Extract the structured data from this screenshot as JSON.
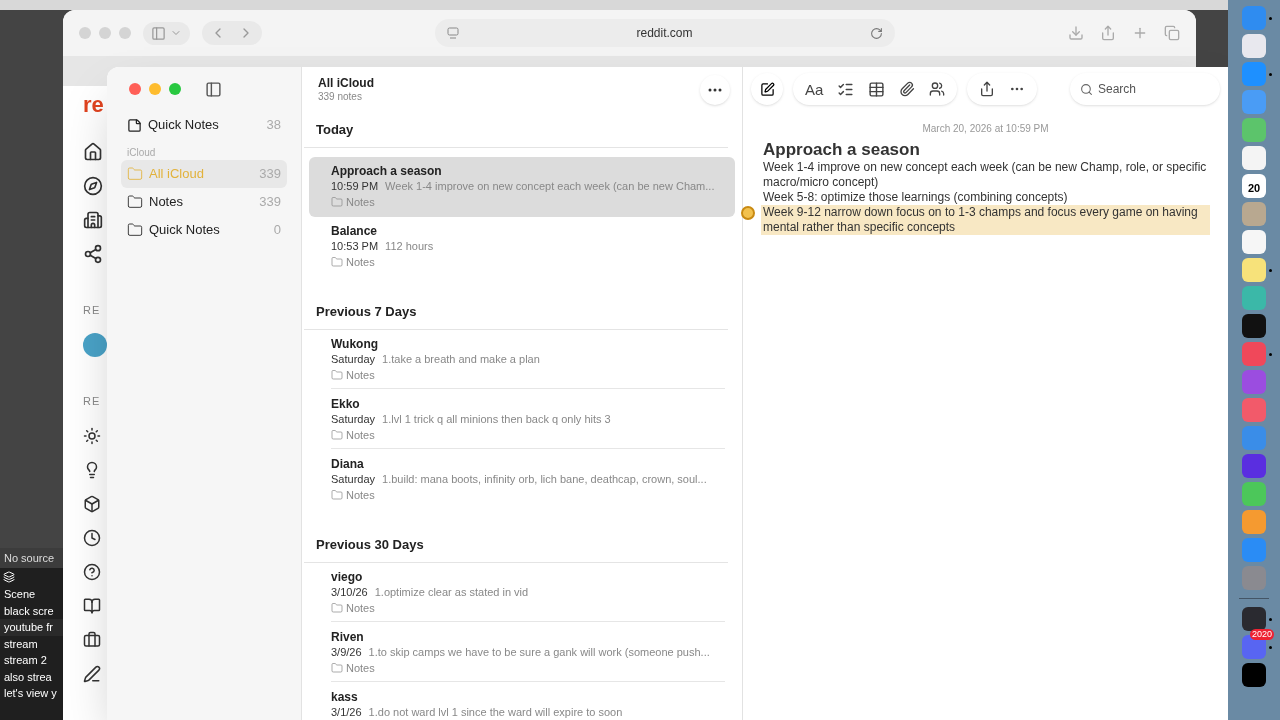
{
  "obs": {
    "status": "No source",
    "scenes": [
      "Scene",
      "black scre",
      "youtube fr",
      "stream",
      "stream 2",
      "also strea",
      "let's view y"
    ]
  },
  "safari": {
    "address": "reddit.com",
    "logo": "re",
    "section_labels": [
      "RE",
      "RE"
    ]
  },
  "notes": {
    "sidebar": {
      "pinned": {
        "label": "Quick Notes",
        "count": "38"
      },
      "group": "iCloud",
      "folders": [
        {
          "label": "All iCloud",
          "count": "339",
          "selected": true
        },
        {
          "label": "Notes",
          "count": "339",
          "selected": false
        },
        {
          "label": "Quick Notes",
          "count": "0",
          "selected": false
        }
      ]
    },
    "list": {
      "title": "All iCloud",
      "subtitle": "339 notes",
      "sections": [
        {
          "heading": "Today",
          "notes": [
            {
              "title": "Approach a season",
              "date": "10:59 PM",
              "preview": "Week 1-4 improve on new concept each week (can be new Cham...",
              "folder": "Notes",
              "selected": true
            },
            {
              "title": "Balance",
              "date": "10:53 PM",
              "preview": "112 hours",
              "folder": "Notes",
              "selected": false
            }
          ]
        },
        {
          "heading": "Previous 7 Days",
          "notes": [
            {
              "title": "Wukong",
              "date": "Saturday",
              "preview": "1.take a breath and make a plan",
              "folder": "Notes",
              "selected": false
            },
            {
              "title": "Ekko",
              "date": "Saturday",
              "preview": "1.lvl 1 trick q all minions then back q only hits 3",
              "folder": "Notes",
              "selected": false
            },
            {
              "title": "Diana",
              "date": "Saturday",
              "preview": "1.build: mana boots, infinity orb, lich bane, deathcap, crown, soul...",
              "folder": "Notes",
              "selected": false
            }
          ]
        },
        {
          "heading": "Previous 30 Days",
          "notes": [
            {
              "title": "viego",
              "date": "3/10/26",
              "preview": "1.optimize clear as stated in vid",
              "folder": "Notes",
              "selected": false
            },
            {
              "title": "Riven",
              "date": "3/9/26",
              "preview": "1.to skip camps we have to be sure a gank will work (someone push...",
              "folder": "Notes",
              "selected": false
            },
            {
              "title": "kass",
              "date": "3/1/26",
              "preview": "1.do not ward lvl 1 since the ward will expire to soon",
              "selected": false
            }
          ]
        }
      ]
    },
    "toolbar": {
      "format_label": "Aa",
      "search_placeholder": "Search"
    },
    "editor": {
      "date": "March 20, 2026 at 10:59 PM",
      "title": "Approach a season",
      "paragraphs": [
        {
          "text": "Week 1-4 improve on new concept each week (can be new Champ, role, or specific macro/micro concept)",
          "highlighted": false
        },
        {
          "text": "Week 5-8: optimize those learnings (combining concepts)",
          "highlighted": false
        },
        {
          "text": "Week 9-12 narrow down focus on to 1-3 champs and focus every game on having mental rather than specific concepts",
          "highlighted": true
        }
      ]
    }
  },
  "dock": [
    {
      "kind": "app",
      "color": "#2f8cf0",
      "running": true
    },
    {
      "kind": "app",
      "color": "#e8e8ee",
      "running": false
    },
    {
      "kind": "app",
      "color": "#1e90ff",
      "running": true
    },
    {
      "kind": "app",
      "color": "#4a9cf5",
      "running": false
    },
    {
      "kind": "app",
      "color": "#5cc46b",
      "running": false
    },
    {
      "kind": "app",
      "color": "#f4f4f4",
      "running": false
    },
    {
      "kind": "calendar",
      "color": "#ffffff",
      "text": "20",
      "running": false
    },
    {
      "kind": "app",
      "color": "#b8a890",
      "running": false
    },
    {
      "kind": "app",
      "color": "#f6f6f6",
      "running": false
    },
    {
      "kind": "app",
      "color": "#f7e27a",
      "running": true
    },
    {
      "kind": "app",
      "color": "#3bb8a8",
      "running": false
    },
    {
      "kind": "app",
      "color": "#111111",
      "running": false
    },
    {
      "kind": "app",
      "color": "#f0485a",
      "running": true
    },
    {
      "kind": "app",
      "color": "#9b4de0",
      "running": false
    },
    {
      "kind": "app",
      "color": "#f25a6a",
      "running": false
    },
    {
      "kind": "app",
      "color": "#3a8de8",
      "running": false
    },
    {
      "kind": "app",
      "color": "#5a2ee0",
      "running": false
    },
    {
      "kind": "app",
      "color": "#4cc75a",
      "running": false
    },
    {
      "kind": "app",
      "color": "#f59a30",
      "running": false
    },
    {
      "kind": "app",
      "color": "#2a8cf5",
      "running": false
    },
    {
      "kind": "app",
      "color": "#8a8a90",
      "running": false
    },
    {
      "kind": "divider"
    },
    {
      "kind": "app",
      "color": "#2a2a30",
      "running": true
    },
    {
      "kind": "app",
      "color": "#5865f2",
      "running": true,
      "badge": "2020"
    },
    {
      "kind": "app",
      "color": "#000000",
      "running": false
    }
  ]
}
